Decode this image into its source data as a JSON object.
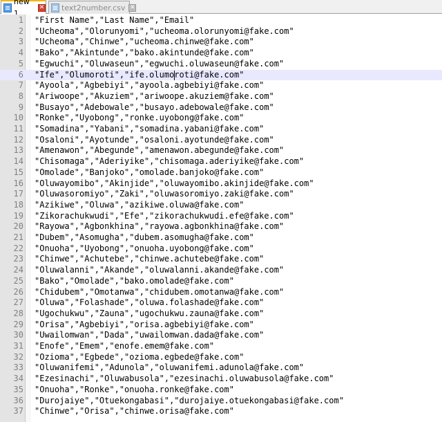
{
  "tabs": [
    {
      "label": "new 1",
      "state": "active"
    },
    {
      "label": "text2number.csv",
      "state": "inactive"
    }
  ],
  "colors": {
    "active_tab_border": "#f7b500",
    "current_line": "#e8e8ff",
    "line_number": "#808080",
    "close_active": "#d9432f"
  },
  "editor": {
    "current_line": 6,
    "lines": [
      "\"First Name\",\"Last Name\",\"Email\"",
      "\"Ucheoma\",\"Olorunyomi\",\"ucheoma.olorunyomi@fake.com\"",
      "\"Ucheoma\",\"Chinwe\",\"ucheoma.chinwe@fake.com\"",
      "\"Bako\",\"Akintunde\",\"bako.akintunde@fake.com\"",
      "\"Egwuchi\",\"Oluwaseun\",\"egwuchi.oluwaseun@fake.com\"",
      "\"Ife\",\"Olumoroti\",\"ife.olumoroti@fake.com\"",
      "\"Ayoola\",\"Agbebiyi\",\"ayoola.agbebiyi@fake.com\"",
      "\"Ariwoope\",\"Akuziem\",\"ariwoope.akuziem@fake.com\"",
      "\"Busayo\",\"Adebowale\",\"busayo.adebowale@fake.com\"",
      "\"Ronke\",\"Uyobong\",\"ronke.uyobong@fake.com\"",
      "\"Somadina\",\"Yabani\",\"somadina.yabani@fake.com\"",
      "\"Osaloni\",\"Ayotunde\",\"osaloni.ayotunde@fake.com\"",
      "\"Amenawon\",\"Abegunde\",\"amenawon.abegunde@fake.com\"",
      "\"Chisomaga\",\"Aderiyike\",\"chisomaga.aderiyike@fake.com\"",
      "\"Omolade\",\"Banjoko\",\"omolade.banjoko@fake.com\"",
      "\"Oluwayomibo\",\"Akinjide\",\"oluwayomibo.akinjide@fake.com\"",
      "\"Oluwasoromiyo\",\"Zaki\",\"oluwasoromiyo.zaki@fake.com\"",
      "\"Azikiwe\",\"Oluwa\",\"azikiwe.oluwa@fake.com\"",
      "\"Zikorachukwudi\",\"Efe\",\"zikorachukwudi.efe@fake.com\"",
      "\"Rayowa\",\"Agbonkhina\",\"rayowa.agbonkhina@fake.com\"",
      "\"Dubem\",\"Asomugha\",\"dubem.asomugha@fake.com\"",
      "\"Onuoha\",\"Uyobong\",\"onuoha.uyobong@fake.com\"",
      "\"Chinwe\",\"Achutebe\",\"chinwe.achutebe@fake.com\"",
      "\"Oluwalanni\",\"Akande\",\"oluwalanni.akande@fake.com\"",
      "\"Bako\",\"Omolade\",\"bako.omolade@fake.com\"",
      "\"Chidubem\",\"Omotanwa\",\"chidubem.omotanwa@fake.com\"",
      "\"Oluwa\",\"Folashade\",\"oluwa.folashade@fake.com\"",
      "\"Ugochukwu\",\"Zauna\",\"ugochukwu.zauna@fake.com\"",
      "\"Orisa\",\"Agbebiyi\",\"orisa.agbebiyi@fake.com\"",
      "\"Uwailomwan\",\"Dada\",\"uwailomwan.dada@fake.com\"",
      "\"Enofe\",\"Emem\",\"enofe.emem@fake.com\"",
      "\"Ozioma\",\"Egbede\",\"ozioma.egbede@fake.com\"",
      "\"Oluwanifemi\",\"Adunola\",\"oluwanifemi.adunola@fake.com\"",
      "\"Ezesinachi\",\"Oluwabusola\",\"ezesinachi.oluwabusola@fake.com\"",
      "\"Onuoha\",\"Ronke\",\"onuoha.ronke@fake.com\"",
      "\"Durojaiye\",\"Otuekongabasi\",\"durojaiye.otuekongabasi@fake.com\"",
      "\"Chinwe\",\"Orisa\",\"chinwe.orisa@fake.com\""
    ]
  }
}
